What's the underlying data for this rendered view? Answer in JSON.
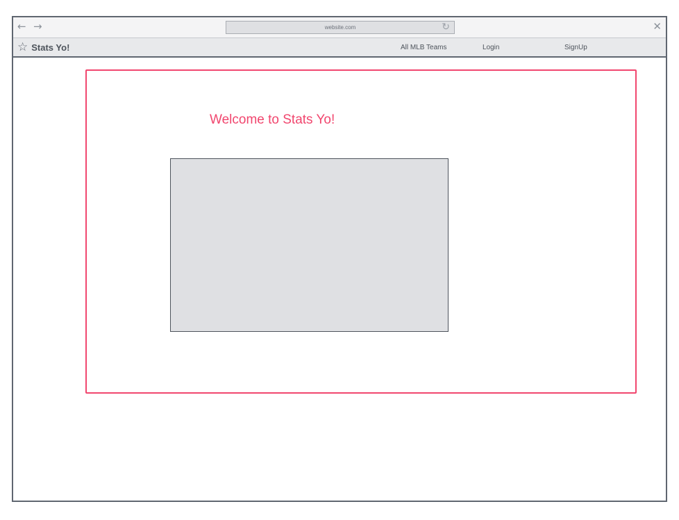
{
  "browser": {
    "back_icon": "arrow-left-icon",
    "forward_icon": "arrow-right-icon",
    "url": "website.com",
    "reload_icon": "reload-icon",
    "close_icon": "close-icon"
  },
  "navbar": {
    "brand_icon": "star-icon",
    "brand_title": "Stats Yo!",
    "links": [
      {
        "label": "All MLB Teams"
      },
      {
        "label": "Login"
      },
      {
        "label": "SignUp"
      }
    ]
  },
  "main": {
    "heading": "Welcome to Stats Yo!"
  },
  "colors": {
    "accent": "#f1466e",
    "frame": "#5f6670",
    "placeholder": "#dfe0e3"
  }
}
